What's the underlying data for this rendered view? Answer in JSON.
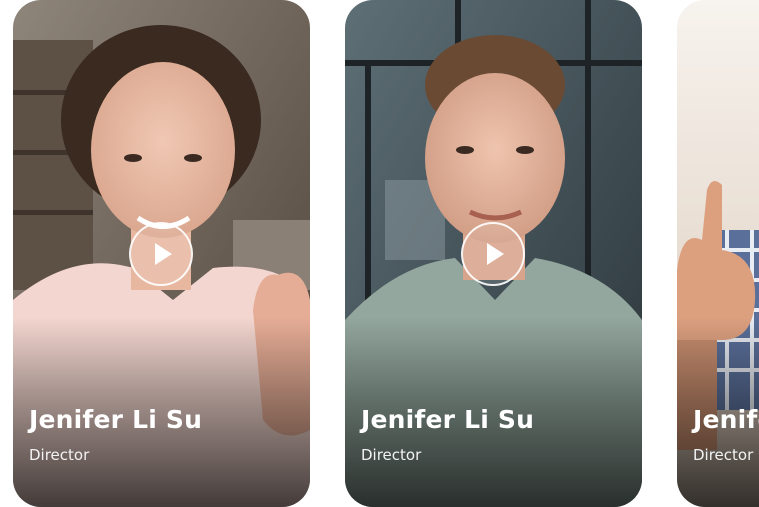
{
  "cards": [
    {
      "name": "Jenifer Li Su",
      "role": "Director",
      "play_icon": "play-icon"
    },
    {
      "name": "Jenifer Li Su",
      "role": "Director",
      "play_icon": "play-icon"
    },
    {
      "name": "Jenifer Li Su",
      "role": "Director",
      "play_icon": "play-icon"
    }
  ],
  "colors": {
    "text": "#ffffff",
    "play_border": "#ffffff"
  }
}
